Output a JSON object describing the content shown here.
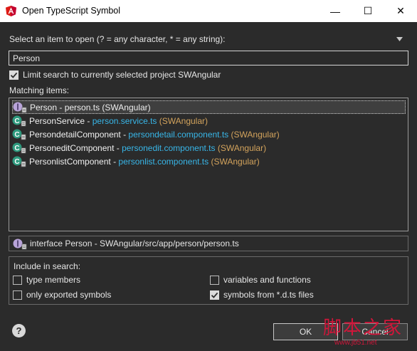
{
  "window": {
    "title": "Open TypeScript Symbol",
    "icon": "angular-icon",
    "minimize_glyph": "—",
    "maximize_glyph": "☐",
    "close_glyph": "✕"
  },
  "prompt": "Select an item to open (? = any character, * = any string):",
  "search": {
    "value": "Person"
  },
  "limit_search": {
    "label": "Limit search to currently selected project SWAngular",
    "checked": true
  },
  "matching_label": "Matching items:",
  "results": [
    {
      "icon": "interface-icon",
      "name": "Person",
      "sep": " - ",
      "file": "person.ts",
      "project": " (SWAngular)",
      "selected": true
    },
    {
      "icon": "class-icon",
      "name": "PersonService",
      "sep": " - ",
      "file": "person.service.ts",
      "project": " (SWAngular)",
      "selected": false
    },
    {
      "icon": "class-icon",
      "name": "PersondetailComponent",
      "sep": " - ",
      "file": "persondetail.component.ts",
      "project": " (SWAngular)",
      "selected": false
    },
    {
      "icon": "class-icon",
      "name": "PersoneditComponent",
      "sep": " - ",
      "file": "personedit.component.ts",
      "project": " (SWAngular)",
      "selected": false
    },
    {
      "icon": "class-icon",
      "name": "PersonlistComponent",
      "sep": " - ",
      "file": "personlist.component.ts",
      "project": " (SWAngular)",
      "selected": false
    }
  ],
  "detail": {
    "icon": "interface-icon",
    "text": "interface Person - SWAngular/src/app/person/person.ts"
  },
  "include": {
    "title": "Include in search:",
    "options": [
      {
        "label": "type members",
        "checked": false
      },
      {
        "label": "variables and functions",
        "checked": false
      },
      {
        "label": "only exported symbols",
        "checked": false
      },
      {
        "label": "symbols from *.d.ts files",
        "checked": true
      }
    ]
  },
  "buttons": {
    "help": "?",
    "ok": "OK",
    "cancel": "Cancel"
  },
  "watermark": {
    "text": "脚本之家",
    "url": "www.jb51.net"
  },
  "colors": {
    "background": "#2b2b2b",
    "file_link": "#38b6e8",
    "project": "#d3a35c",
    "interface_badge": "#b9a4d9",
    "class_badge": "#2e9a7e",
    "angular": "#dd1b16"
  }
}
